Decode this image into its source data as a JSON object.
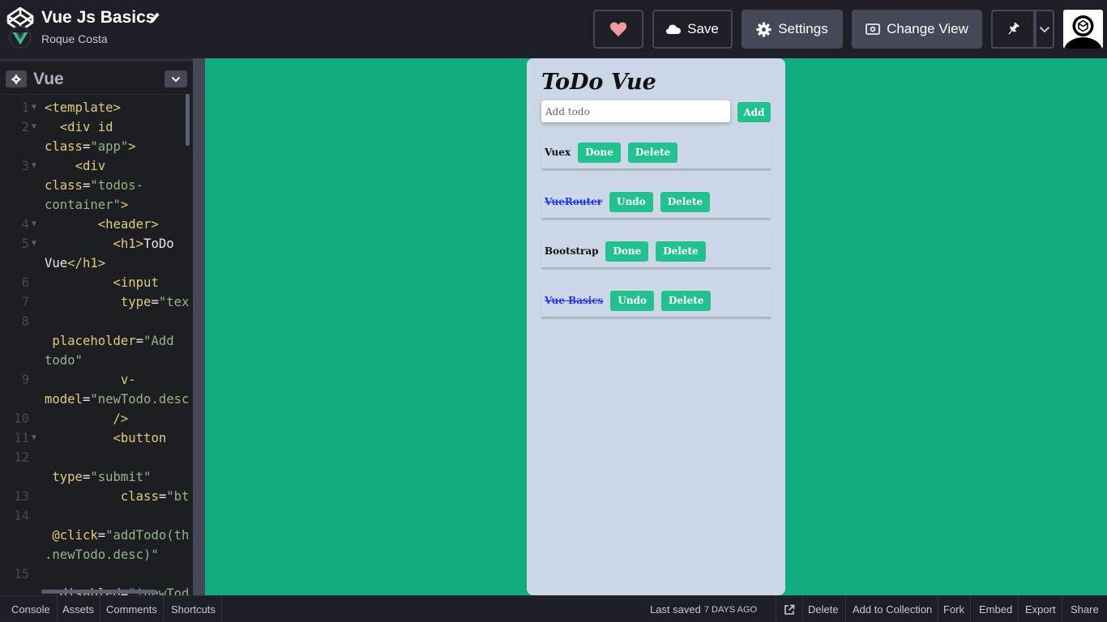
{
  "header": {
    "pen_title": "Vue Js Basics",
    "author": "Roque Costa",
    "buttons": {
      "save": "Save",
      "settings": "Settings",
      "change_view": "Change View"
    }
  },
  "editor": {
    "language": "Vue",
    "lines": [
      {
        "n": "1",
        "fold": true,
        "parts": [
          [
            "tg",
            "<template>"
          ]
        ]
      },
      {
        "n": "2",
        "fold": true,
        "parts": [
          [
            "pl",
            "  "
          ],
          [
            "tg",
            "<div "
          ],
          [
            "at",
            "id"
          ]
        ]
      },
      {
        "n": "",
        "fold": false,
        "parts": [
          [
            "at",
            "class"
          ],
          [
            "pl",
            "="
          ],
          [
            "st",
            "\"app\""
          ],
          [
            "tg",
            ">"
          ]
        ]
      },
      {
        "n": "3",
        "fold": true,
        "parts": [
          [
            "pl",
            "    "
          ],
          [
            "tg",
            "<div"
          ]
        ]
      },
      {
        "n": "",
        "fold": false,
        "parts": [
          [
            "at",
            "class"
          ],
          [
            "pl",
            "="
          ],
          [
            "st",
            "\"todos-"
          ]
        ]
      },
      {
        "n": "",
        "fold": false,
        "parts": [
          [
            "st",
            "container\""
          ],
          [
            "tg",
            ">"
          ]
        ]
      },
      {
        "n": "4",
        "fold": true,
        "parts": [
          [
            "pl",
            "       "
          ],
          [
            "tg",
            "<header>"
          ]
        ]
      },
      {
        "n": "5",
        "fold": true,
        "parts": [
          [
            "pl",
            "         "
          ],
          [
            "tg",
            "<h1>"
          ],
          [
            "pl",
            "ToDo"
          ]
        ]
      },
      {
        "n": "",
        "fold": false,
        "parts": [
          [
            "pl",
            "Vue"
          ],
          [
            "tg",
            "</h1>"
          ]
        ]
      },
      {
        "n": "6",
        "fold": false,
        "parts": [
          [
            "pl",
            "         "
          ],
          [
            "tg",
            "<input"
          ]
        ]
      },
      {
        "n": "7",
        "fold": false,
        "parts": [
          [
            "pl",
            "          "
          ],
          [
            "at",
            "type"
          ],
          [
            "pl",
            "="
          ],
          [
            "st",
            "\"tex"
          ]
        ]
      },
      {
        "n": "8",
        "fold": false,
        "parts": []
      },
      {
        "n": "",
        "fold": false,
        "parts": [
          [
            "pl",
            " "
          ],
          [
            "at",
            "placeholder"
          ],
          [
            "pl",
            "="
          ],
          [
            "st",
            "\"Add"
          ]
        ]
      },
      {
        "n": "",
        "fold": false,
        "parts": [
          [
            "st",
            "todo\""
          ]
        ]
      },
      {
        "n": "9",
        "fold": false,
        "parts": [
          [
            "pl",
            "          "
          ],
          [
            "at",
            "v-"
          ]
        ]
      },
      {
        "n": "",
        "fold": false,
        "parts": [
          [
            "at",
            "model"
          ],
          [
            "pl",
            "="
          ],
          [
            "st",
            "\"newTodo.desc"
          ]
        ]
      },
      {
        "n": "10",
        "fold": false,
        "parts": [
          [
            "pl",
            "         "
          ],
          [
            "tg",
            "/>"
          ]
        ]
      },
      {
        "n": "11",
        "fold": true,
        "parts": [
          [
            "pl",
            "         "
          ],
          [
            "tg",
            "<button"
          ]
        ]
      },
      {
        "n": "12",
        "fold": false,
        "parts": []
      },
      {
        "n": "",
        "fold": false,
        "parts": [
          [
            "pl",
            " "
          ],
          [
            "at",
            "type"
          ],
          [
            "pl",
            "="
          ],
          [
            "st",
            "\"submit\""
          ]
        ]
      },
      {
        "n": "13",
        "fold": false,
        "parts": [
          [
            "pl",
            "          "
          ],
          [
            "at",
            "class"
          ],
          [
            "pl",
            "="
          ],
          [
            "st",
            "\"bt"
          ]
        ]
      },
      {
        "n": "14",
        "fold": false,
        "parts": []
      },
      {
        "n": "",
        "fold": false,
        "parts": [
          [
            "pl",
            " "
          ],
          [
            "at",
            "@click"
          ],
          [
            "pl",
            "="
          ],
          [
            "st",
            "\"addTodo(th"
          ]
        ]
      },
      {
        "n": "",
        "fold": false,
        "parts": [
          [
            "st",
            ".newTodo.desc)\""
          ]
        ]
      },
      {
        "n": "15",
        "fold": false,
        "parts": []
      },
      {
        "n": "",
        "fold": false,
        "parts": [
          [
            "pl",
            " "
          ],
          [
            "at",
            ":disabled"
          ],
          [
            "pl",
            "="
          ],
          [
            "st",
            "\"!newTod"
          ]
        ]
      }
    ]
  },
  "preview": {
    "title": "ToDo Vue",
    "input_placeholder": "Add todo",
    "add_label": "Add",
    "todos": [
      {
        "desc": "Vuex",
        "done": false,
        "toggle_label": "Done",
        "delete_label": "Delete"
      },
      {
        "desc": "VueRouter",
        "done": true,
        "toggle_label": "Undo",
        "delete_label": "Delete"
      },
      {
        "desc": "Bootstrap",
        "done": false,
        "toggle_label": "Done",
        "delete_label": "Delete"
      },
      {
        "desc": "Vue Basics",
        "done": true,
        "toggle_label": "Undo",
        "delete_label": "Delete"
      }
    ]
  },
  "footer": {
    "console": "Console",
    "assets": "Assets",
    "comments": "Comments",
    "shortcuts": "Shortcuts",
    "last_saved": "Last saved",
    "last_saved_ago": "7 days ago",
    "delete": "Delete",
    "add_to_collection": "Add to Collection",
    "fork": "Fork",
    "embed": "Embed",
    "export": "Export",
    "share": "Share"
  },
  "colors": {
    "preview_bg": "#11ad7f",
    "todo_button": "#22c28f",
    "heart": "#f29a9a",
    "header_bg": "#1e1f26"
  }
}
